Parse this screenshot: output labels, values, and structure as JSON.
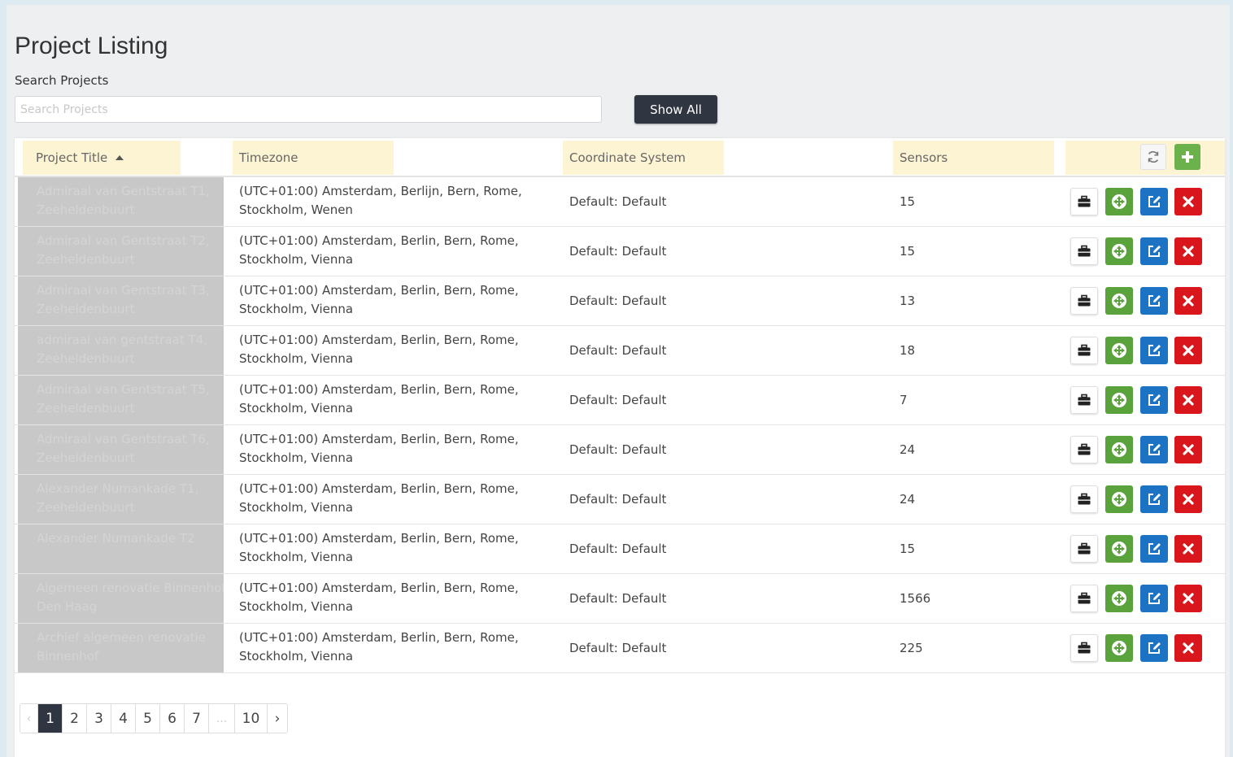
{
  "page": {
    "title": "Project Listing",
    "search_label": "Search Projects",
    "search_placeholder": "Search Projects",
    "search_value": "",
    "show_all_label": "Show All"
  },
  "table": {
    "columns": [
      "Project Title",
      "Timezone",
      "Coordinate System",
      "Sensors"
    ],
    "sorted_column": "Project Title",
    "sort_direction": "ascending",
    "header_icons": [
      "refresh-icon",
      "plus-icon"
    ],
    "action_icons": [
      "briefcase-icon",
      "move-icon",
      "edit-icon",
      "close-icon"
    ],
    "rows": [
      {
        "title": [
          "Admiraal van Gentstraat T1,",
          "Zeeheldenbuurt"
        ],
        "tz": [
          "(UTC+01:00) Amsterdam, Berlijn, Bern, Rome,",
          "Stockholm, Wenen"
        ],
        "coord": "Default: Default",
        "sensors": "15"
      },
      {
        "title": [
          "Admiraal van Gentstraat T2,",
          "Zeeheldenbuurt"
        ],
        "tz": [
          "(UTC+01:00) Amsterdam, Berlin, Bern, Rome,",
          "Stockholm, Vienna"
        ],
        "coord": "Default: Default",
        "sensors": "15"
      },
      {
        "title": [
          "Admiraal van Gentstraat T3,",
          "Zeeheldenbuurt"
        ],
        "tz": [
          "(UTC+01:00) Amsterdam, Berlin, Bern, Rome,",
          "Stockholm, Vienna"
        ],
        "coord": "Default: Default",
        "sensors": "13"
      },
      {
        "title": [
          "admiraal van gentstraat T4,",
          "Zeeheldenbuurt"
        ],
        "tz": [
          "(UTC+01:00) Amsterdam, Berlin, Bern, Rome,",
          "Stockholm, Vienna"
        ],
        "coord": "Default: Default",
        "sensors": "18"
      },
      {
        "title": [
          "Admiraal van Gentstraat T5,",
          "Zeeheldenbuurt"
        ],
        "tz": [
          "(UTC+01:00) Amsterdam, Berlin, Bern, Rome,",
          "Stockholm, Vienna"
        ],
        "coord": "Default: Default",
        "sensors": "7"
      },
      {
        "title": [
          "Admiraal van Gentstraat T6,",
          "Zeeheldenbuurt"
        ],
        "tz": [
          "(UTC+01:00) Amsterdam, Berlin, Bern, Rome,",
          "Stockholm, Vienna"
        ],
        "coord": "Default: Default",
        "sensors": "24"
      },
      {
        "title": [
          "Alexander Numankade T1,",
          "Zeeheldenbuurt"
        ],
        "tz": [
          "(UTC+01:00) Amsterdam, Berlin, Bern, Rome,",
          "Stockholm, Vienna"
        ],
        "coord": "Default: Default",
        "sensors": "24"
      },
      {
        "title": [
          "",
          "Alexander Numankade T2"
        ],
        "tz": [
          "(UTC+01:00) Amsterdam, Berlin, Bern, Rome,",
          "Stockholm, Vienna"
        ],
        "coord": "Default: Default",
        "sensors": "15"
      },
      {
        "title": [
          "Algemeen renovatie Binnenhof,",
          "Den Haag"
        ],
        "tz": [
          "(UTC+01:00) Amsterdam, Berlin, Bern, Rome,",
          "Stockholm, Vienna"
        ],
        "coord": "Default: Default",
        "sensors": "1566"
      },
      {
        "title": [
          "Archief algemeen renovatie",
          "Binnenhof"
        ],
        "tz": [
          "(UTC+01:00) Amsterdam, Berlin, Bern, Rome,",
          "Stockholm, Vienna"
        ],
        "coord": "Default: Default",
        "sensors": "225"
      }
    ]
  },
  "pagination": {
    "prev": "‹",
    "pages": [
      "1",
      "2",
      "3",
      "4",
      "5",
      "6",
      "7",
      "...",
      "10"
    ],
    "current": "1",
    "next": "›"
  },
  "colors": {
    "header_highlight": "#fdf4d3",
    "dark_button": "#2f3541",
    "move_green": "#5aa33c",
    "add_green": "#6cb24c",
    "edit_blue": "#1c73c4",
    "delete_red": "#d9161b"
  }
}
